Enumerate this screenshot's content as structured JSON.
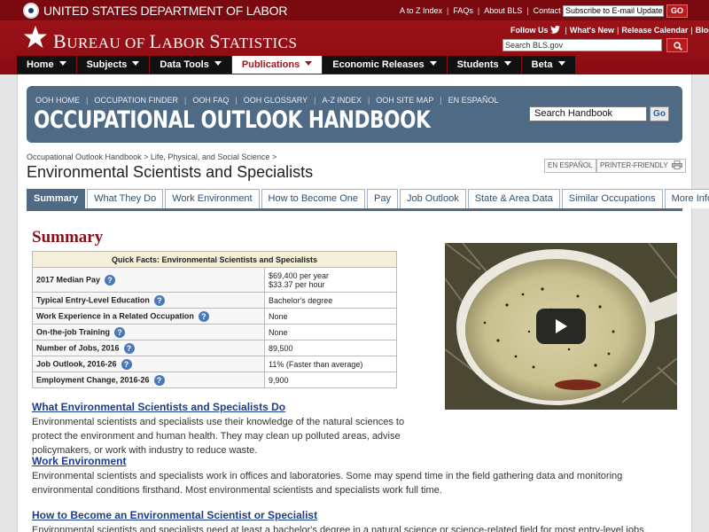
{
  "header": {
    "dol_name": "UNITED STATES DEPARTMENT OF LABOR",
    "util_links": [
      "A to Z Index",
      "FAQs",
      "About BLS",
      "Contact Us"
    ],
    "email_placeholder": "Subscribe to E-mail Updates",
    "email_go": "GO",
    "bls_name_parts": [
      "B",
      "UREAU OF ",
      "L",
      "ABOR ",
      "S",
      "TATISTICS"
    ],
    "social": {
      "follow_us": "Follow Us",
      "whats_new": "What's New",
      "release_calendar": "Release Calendar",
      "blog": "Blog"
    },
    "search_placeholder": "Search BLS.gov",
    "nav": [
      {
        "label": "Home"
      },
      {
        "label": "Subjects"
      },
      {
        "label": "Data Tools"
      },
      {
        "label": "Publications"
      },
      {
        "label": "Economic Releases"
      },
      {
        "label": "Students"
      },
      {
        "label": "Beta"
      }
    ],
    "active_nav": "Publications"
  },
  "ooh": {
    "links": [
      "OOH HOME",
      "OCCUPATION FINDER",
      "OOH FAQ",
      "OOH GLOSSARY",
      "A-Z INDEX",
      "OOH SITE MAP",
      "EN ESPAÑOL"
    ],
    "title": "OCCUPATIONAL OUTLOOK HANDBOOK",
    "search_value": "Search Handbook",
    "go": "Go"
  },
  "breadcrumb": [
    "Occupational Outlook Handbook",
    "Life, Physical, and Social Science"
  ],
  "page": {
    "title": "Environmental Scientists and Specialists",
    "en_espanol": "EN ESPAÑOL",
    "printer_friendly": "PRINTER-FRIENDLY"
  },
  "tabs": [
    "Summary",
    "What They Do",
    "Work Environment",
    "How to Become One",
    "Pay",
    "Job Outlook",
    "State & Area Data",
    "Similar Occupations",
    "More Info"
  ],
  "active_tab": "Summary",
  "summary": {
    "heading": "Summary",
    "table_title": "Quick Facts: Environmental Scientists and Specialists",
    "rows": [
      {
        "label": "2017 Median Pay",
        "value": "$69,400 per year",
        "value2": "$33.37 per hour"
      },
      {
        "label": "Typical Entry-Level Education",
        "value": "Bachelor's degree"
      },
      {
        "label": "Work Experience in a Related Occupation",
        "value": "None"
      },
      {
        "label": "On-the-job Training",
        "value": "None"
      },
      {
        "label": "Number of Jobs, 2016",
        "value": "89,500"
      },
      {
        "label": "Job Outlook, 2016-26",
        "value": "11% (Faster than average)"
      },
      {
        "label": "Employment Change, 2016-26",
        "value": "9,900"
      }
    ]
  },
  "sections": [
    {
      "title": "What Environmental Scientists and Specialists Do",
      "text": "Environmental scientists and specialists use their knowledge of the natural sciences to protect the environment and human health. They may clean up polluted areas, advise policymakers, or work with industry to reduce waste."
    },
    {
      "title": "Work Environment",
      "text": "Environmental scientists and specialists work in offices and laboratories. Some may spend time in the field gathering data and monitoring environmental conditions firsthand. Most environmental scientists and specialists work full time."
    },
    {
      "title": "How to Become an Environmental Scientist or Specialist",
      "text": "Environmental scientists and specialists need at least a bachelor's degree in a natural science or science-related field for most entry-level jobs."
    }
  ],
  "colors": {
    "header_red": "#a3141b",
    "ooh_blue": "#4f6a84",
    "link_blue": "#1a3d8f",
    "heading_red": "#8b1016"
  }
}
